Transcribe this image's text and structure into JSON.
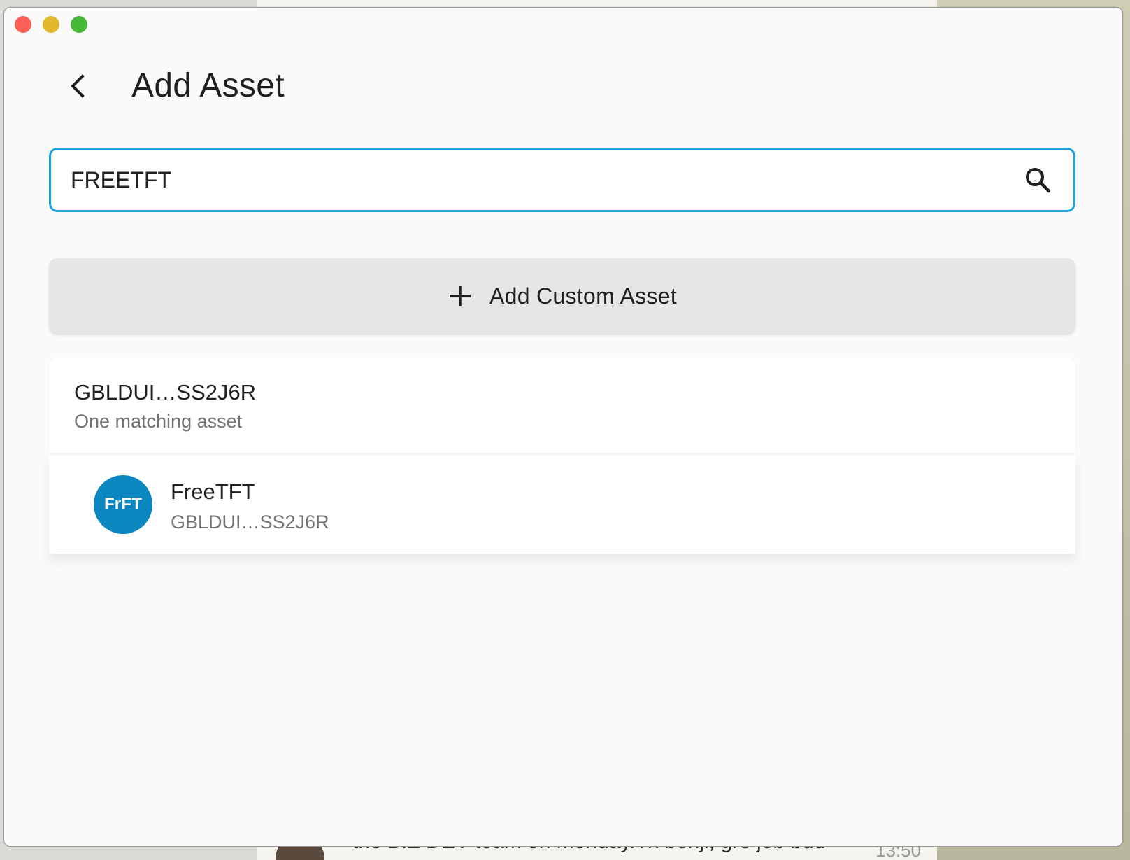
{
  "background": {
    "chat_snippet": "the BIZ DEV team on monday.Tx benji, gr8 job bud",
    "chat_time": "13:50"
  },
  "window": {
    "controls": [
      "close",
      "minimize",
      "maximize"
    ]
  },
  "header": {
    "back_icon": "chevron-left-icon",
    "title": "Add Asset"
  },
  "search": {
    "value": "FREETFT",
    "placeholder": "",
    "icon": "search-icon"
  },
  "add_custom": {
    "icon": "plus-icon",
    "label": "Add Custom Asset"
  },
  "results": {
    "group_title": "GBLDUI…SS2J6R",
    "group_subtitle": "One matching asset",
    "assets": [
      {
        "avatar_text": "FrFT",
        "name": "FreeTFT",
        "issuer": "GBLDUI…SS2J6R",
        "avatar_color": "#0a86c0"
      }
    ]
  },
  "colors": {
    "accent": "#1aa3e0",
    "avatar": "#0a86c0"
  }
}
